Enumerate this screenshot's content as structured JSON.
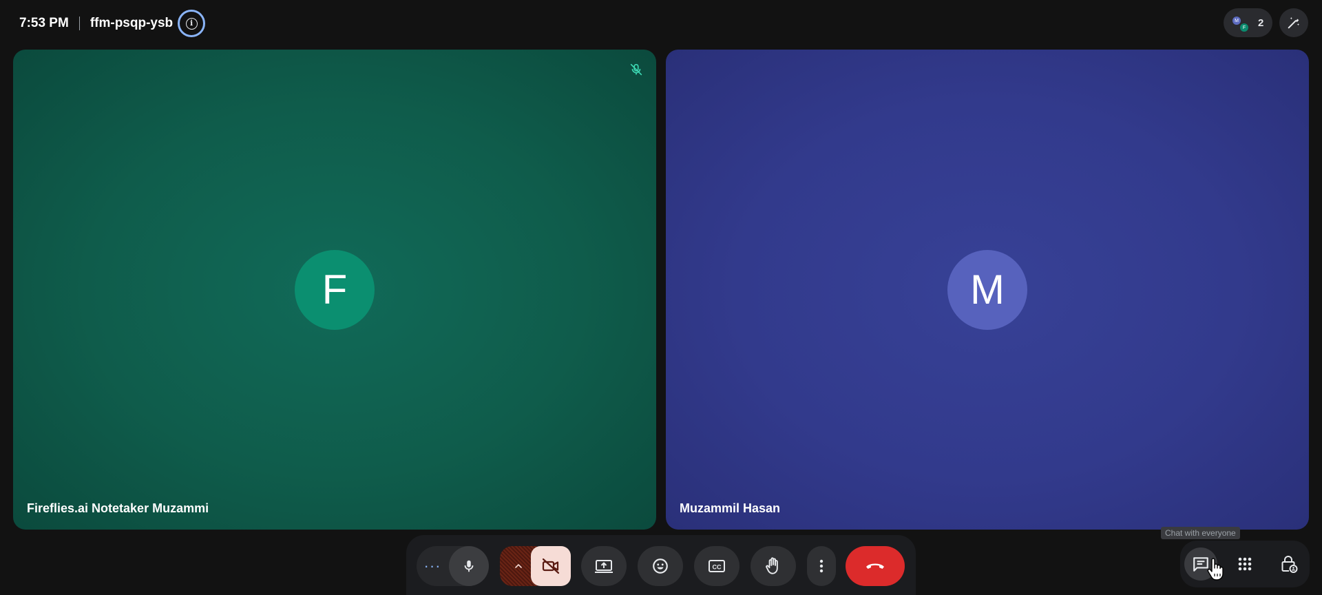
{
  "header": {
    "time": "7:53 PM",
    "meeting_code": "ffm-psqp-ysb",
    "info_icon": "info-icon",
    "participant_count": "2",
    "participant_avatars": [
      "M",
      "F"
    ],
    "activities_icon": "magic-pen-icon"
  },
  "tiles": [
    {
      "initial": "F",
      "name": "Fireflies.ai Notetaker Muzammi",
      "color": "#0b8f70",
      "background": "#0f5c4b",
      "muted": true
    },
    {
      "initial": "M",
      "name": "Muzammil Hasan",
      "color": "#5762bd",
      "background": "#323a8c",
      "muted": false
    }
  ],
  "controls": {
    "more_label": "···",
    "items": [
      "mic-icon",
      "camera-options-chevron-icon",
      "camera-off-icon",
      "present-screen-icon",
      "emoji-icon",
      "captions-icon",
      "raise-hand-icon",
      "more-vertical-icon",
      "hangup-icon"
    ],
    "camera_off_color": "#f6dcd6",
    "hangup_color": "#dc2b2b"
  },
  "right_controls": {
    "chat_tooltip": "Chat with everyone",
    "items": [
      "chat-icon",
      "apps-grid-icon",
      "host-controls-lock-icon"
    ]
  }
}
